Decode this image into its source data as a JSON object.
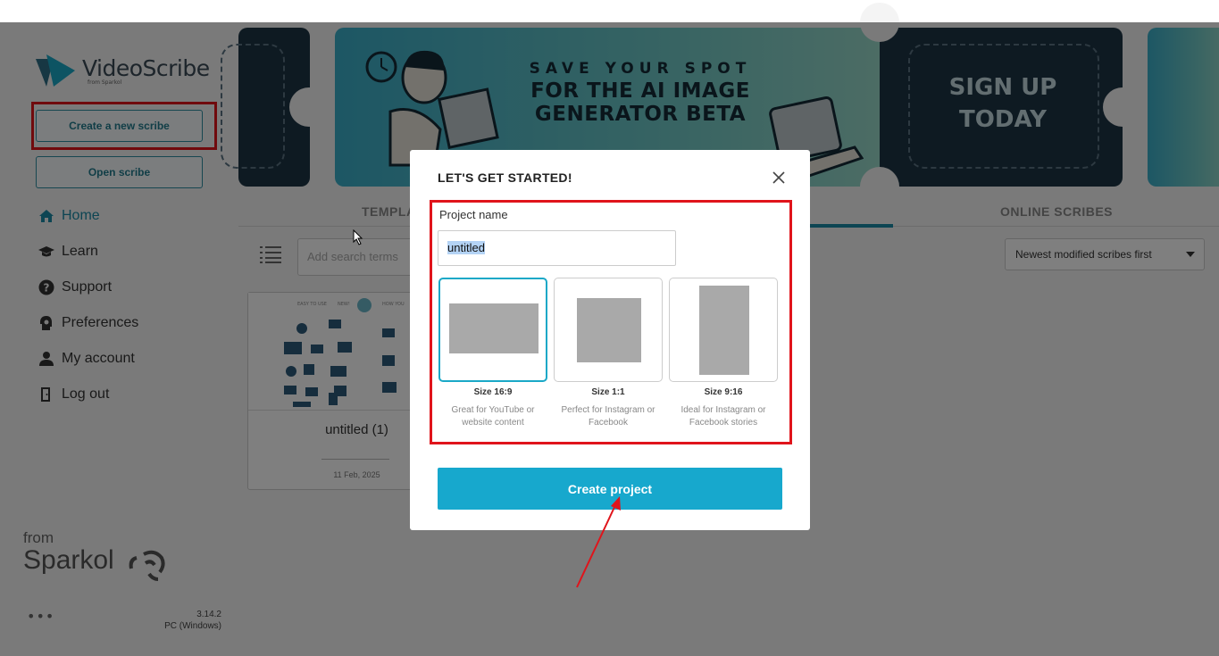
{
  "app": {
    "name": "VideoScribe",
    "byline": "from Sparkol"
  },
  "sidebar": {
    "create_label": "Create a new scribe",
    "open_label": "Open scribe",
    "nav": [
      {
        "label": "Home",
        "icon": "home-icon",
        "active": true
      },
      {
        "label": "Learn",
        "icon": "graduation-cap-icon",
        "active": false
      },
      {
        "label": "Support",
        "icon": "question-circle-icon",
        "active": false
      },
      {
        "label": "Preferences",
        "icon": "gear-head-icon",
        "active": false
      },
      {
        "label": "My account",
        "icon": "user-icon",
        "active": false
      },
      {
        "label": "Log out",
        "icon": "door-exit-icon",
        "active": false
      }
    ],
    "from_label": "from",
    "brand": "Sparkol",
    "more": "•••",
    "version": "3.14.2",
    "platform": "PC (Windows)"
  },
  "banner": {
    "line1": "SAVE YOUR SPOT",
    "line2": "FOR THE AI IMAGE",
    "line3": "GENERATOR BETA",
    "cta1": "SIGN UP",
    "cta2": "TODAY"
  },
  "tabs": {
    "templates": "TEMPLA",
    "online": "ONLINE SCRIBES"
  },
  "toolbar": {
    "search_placeholder": "Add search terms",
    "sort_value": "Newest modified scribes first"
  },
  "scribes": [
    {
      "title": "untitled (1)",
      "date": "11 Feb, 2025"
    }
  ],
  "modal": {
    "title": "LET'S GET STARTED!",
    "project_name_label": "Project name",
    "project_name_value": "untitled",
    "sizes": [
      {
        "name": "Size 16:9",
        "desc": "Great for YouTube or website content",
        "selected": true
      },
      {
        "name": "Size 1:1",
        "desc": "Perfect for Instagram or Facebook",
        "selected": false
      },
      {
        "name": "Size 9:16",
        "desc": "Ideal for Instagram or Facebook stories",
        "selected": false
      }
    ],
    "create_label": "Create project"
  },
  "colors": {
    "accent": "#17a8cd",
    "highlight": "#e0141b",
    "banner_dark": "#1d3444"
  }
}
